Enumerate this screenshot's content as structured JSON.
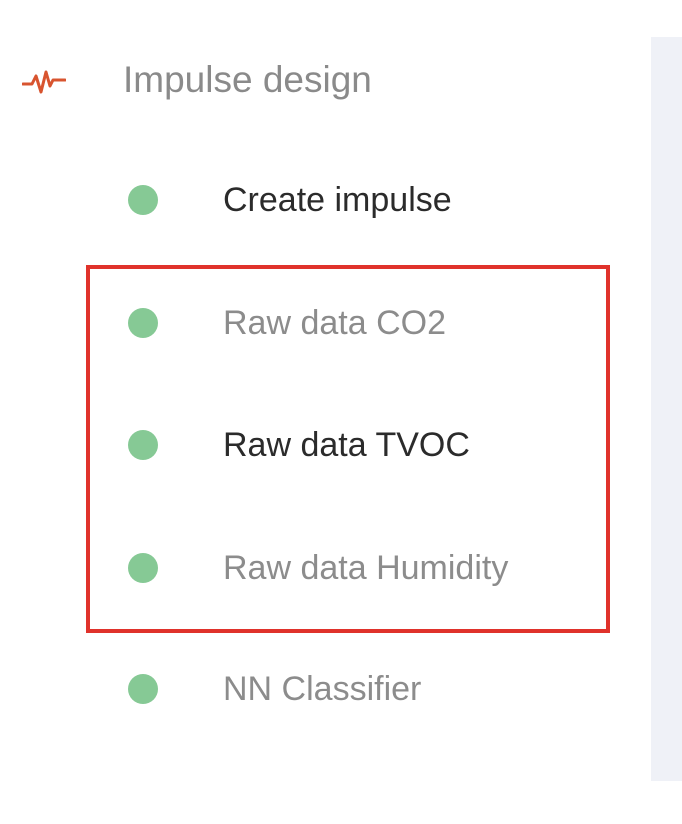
{
  "section": {
    "title": "Impulse design",
    "icon": "pulse-icon",
    "icon_color": "#d8542f"
  },
  "nav_items": [
    {
      "label": "Create impulse",
      "state": "active"
    },
    {
      "label": "Raw data CO2",
      "state": "muted"
    },
    {
      "label": "Raw data TVOC",
      "state": "active"
    },
    {
      "label": "Raw data Humidity",
      "state": "muted"
    },
    {
      "label": "NN Classifier",
      "state": "muted"
    }
  ],
  "status_dot_color": "#86c995",
  "highlight_color": "#e0322b"
}
